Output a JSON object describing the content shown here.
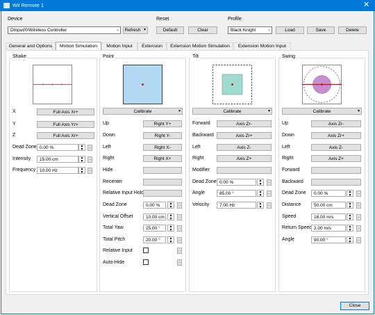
{
  "window": {
    "title": "Wii Remote 1",
    "close_glyph": "✕"
  },
  "device": {
    "label": "Device",
    "value": "DInput/0/Wireless Controller",
    "refresh": "Refresh"
  },
  "reset": {
    "label": "Reset",
    "default": "Default",
    "clear": "Clear"
  },
  "profile": {
    "label": "Profile",
    "value": "Black Knight",
    "load": "Load",
    "save": "Save",
    "delete": "Delete"
  },
  "tabs": [
    "General and Options",
    "Motion Simulation",
    "Motion Input",
    "Extension",
    "Extension Motion Simulation",
    "Extension Motion Input"
  ],
  "shake": {
    "title": "Shake",
    "rows": [
      {
        "label": "X",
        "value": "Full Axis Xr+"
      },
      {
        "label": "Y",
        "value": "Full Axis Yr+"
      },
      {
        "label": "Z",
        "value": "Full Axis Xr+"
      }
    ],
    "settings": [
      {
        "label": "Dead Zone",
        "value": "0.00 %"
      },
      {
        "label": "Intensity",
        "value": "15.00 cm"
      },
      {
        "label": "Frequency",
        "value": "10.00 Hz"
      }
    ]
  },
  "point": {
    "title": "Point",
    "calibrate": "Calibrate",
    "rows": [
      {
        "label": "Up",
        "value": "Right Y+"
      },
      {
        "label": "Down",
        "value": "Right Y-"
      },
      {
        "label": "Left",
        "value": "Right X-"
      },
      {
        "label": "Right",
        "value": "Right X+"
      },
      {
        "label": "Hide",
        "value": ""
      },
      {
        "label": "Recenter",
        "value": ""
      },
      {
        "label": "Relative Input Hold",
        "value": ""
      }
    ],
    "settings": [
      {
        "label": "Dead Zone",
        "value": "0.00 %"
      },
      {
        "label": "Vertical Offset",
        "value": "10.00 cm"
      },
      {
        "label": "Total Yaw",
        "value": "25.00 °"
      },
      {
        "label": "Total Pitch",
        "value": "20.00 °"
      }
    ],
    "checks": [
      {
        "label": "Relative Input"
      },
      {
        "label": "Auto-Hide"
      }
    ]
  },
  "tilt": {
    "title": "Tilt",
    "calibrate": "Calibrate",
    "rows": [
      {
        "label": "Forward",
        "value": "Axis Zr-"
      },
      {
        "label": "Backward",
        "value": "Axis Zr+"
      },
      {
        "label": "Left",
        "value": "Axis Z-"
      },
      {
        "label": "Right",
        "value": "Axis Z+"
      },
      {
        "label": "Modifier",
        "value": ""
      }
    ],
    "settings": [
      {
        "label": "Dead Zone",
        "value": "0.00 %"
      },
      {
        "label": "Angle",
        "value": "85.00 °"
      },
      {
        "label": "Velocity",
        "value": "7.00 Hz"
      }
    ]
  },
  "swing": {
    "title": "Swing",
    "calibrate": "Calibrate",
    "rows": [
      {
        "label": "Up",
        "value": "Axis Zr-"
      },
      {
        "label": "Down",
        "value": "Axis Zr+"
      },
      {
        "label": "Left",
        "value": "Axis Z-"
      },
      {
        "label": "Right",
        "value": "Axis Z+"
      },
      {
        "label": "Forward",
        "value": ""
      },
      {
        "label": "Backward",
        "value": ""
      }
    ],
    "settings": [
      {
        "label": "Dead Zone",
        "value": "0.00 %"
      },
      {
        "label": "Distance",
        "value": "50.00 cm"
      },
      {
        "label": "Speed",
        "value": "16.00 m/s"
      },
      {
        "label": "Return Speed",
        "value": "2.00 m/s"
      },
      {
        "label": "Angle",
        "value": "90.00 °"
      }
    ]
  },
  "footer": {
    "close": "Close"
  },
  "colors": {
    "accent": "#0078d7",
    "point_fill": "#b3d9f2",
    "tilt_fill": "#9fdccf",
    "swing_fill": "#c58fd1",
    "indicator_dot": "#d00000"
  }
}
